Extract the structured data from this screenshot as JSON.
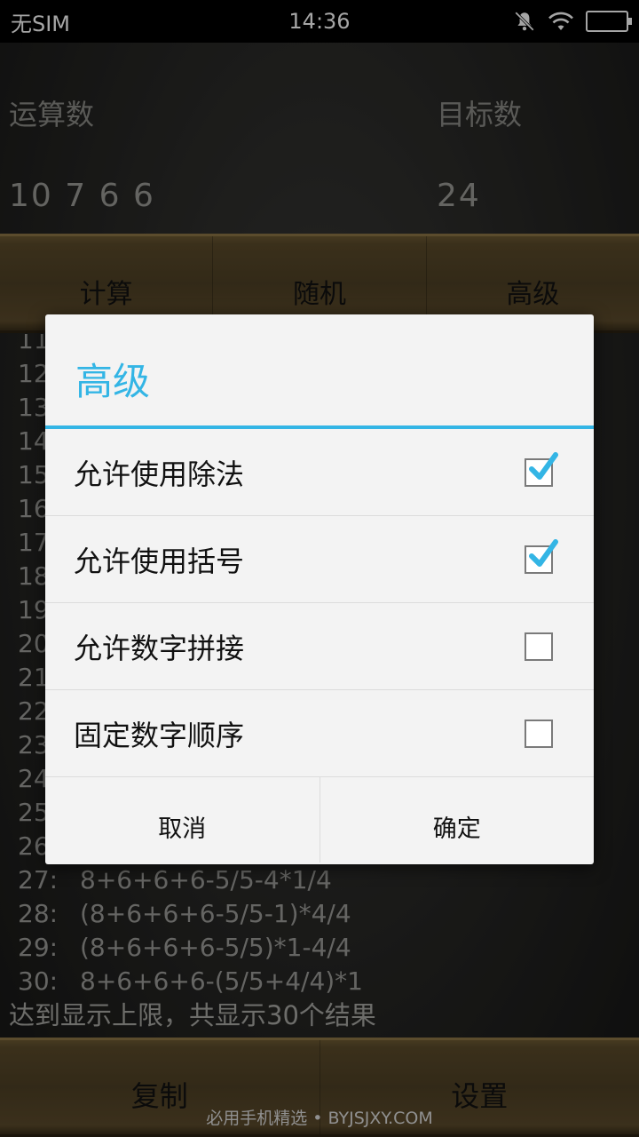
{
  "status": {
    "carrier": "无SIM",
    "time": "14:36"
  },
  "inputs": {
    "operands_label": "运算数",
    "operands_value": "10 7 6 6",
    "target_label": "目标数",
    "target_value": "24"
  },
  "tabs": [
    {
      "label": "计算"
    },
    {
      "label": "随机"
    },
    {
      "label": "高级"
    }
  ],
  "results": {
    "rows": [
      {
        "num": "11",
        "expr": ""
      },
      {
        "num": "12",
        "expr": ""
      },
      {
        "num": "13",
        "expr": ""
      },
      {
        "num": "14",
        "expr": ""
      },
      {
        "num": "15",
        "expr": ""
      },
      {
        "num": "16",
        "expr": ""
      },
      {
        "num": "17",
        "expr": ""
      },
      {
        "num": "18",
        "expr": ""
      },
      {
        "num": "19",
        "expr": ""
      },
      {
        "num": "20",
        "expr": ""
      },
      {
        "num": "21",
        "expr": ""
      },
      {
        "num": "22",
        "expr": ""
      },
      {
        "num": "23",
        "expr": ""
      },
      {
        "num": "24",
        "expr": ""
      },
      {
        "num": "25",
        "expr": ""
      },
      {
        "num": "26",
        "expr": ""
      },
      {
        "num": "27:",
        "expr": "8+6+6+6-5/5-4*1/4"
      },
      {
        "num": "28:",
        "expr": "(8+6+6+6-5/5-1)*4/4"
      },
      {
        "num": "29:",
        "expr": "(8+6+6+6-5/5)*1-4/4"
      },
      {
        "num": "30:",
        "expr": "8+6+6+6-(5/5+4/4)*1"
      }
    ],
    "limit_message": "达到显示上限，共显示30个结果"
  },
  "bottom": {
    "copy_label": "复制",
    "settings_label": "设置"
  },
  "watermark": "必用手机精选 • BYJSJXY.COM",
  "dialog": {
    "title": "高级",
    "options": [
      {
        "label": "允许使用除法",
        "checked": true
      },
      {
        "label": "允许使用括号",
        "checked": true
      },
      {
        "label": "允许数字拼接",
        "checked": false
      },
      {
        "label": "固定数字顺序",
        "checked": false
      }
    ],
    "cancel_label": "取消",
    "ok_label": "确定"
  },
  "colors": {
    "accent": "#33b5e5"
  }
}
